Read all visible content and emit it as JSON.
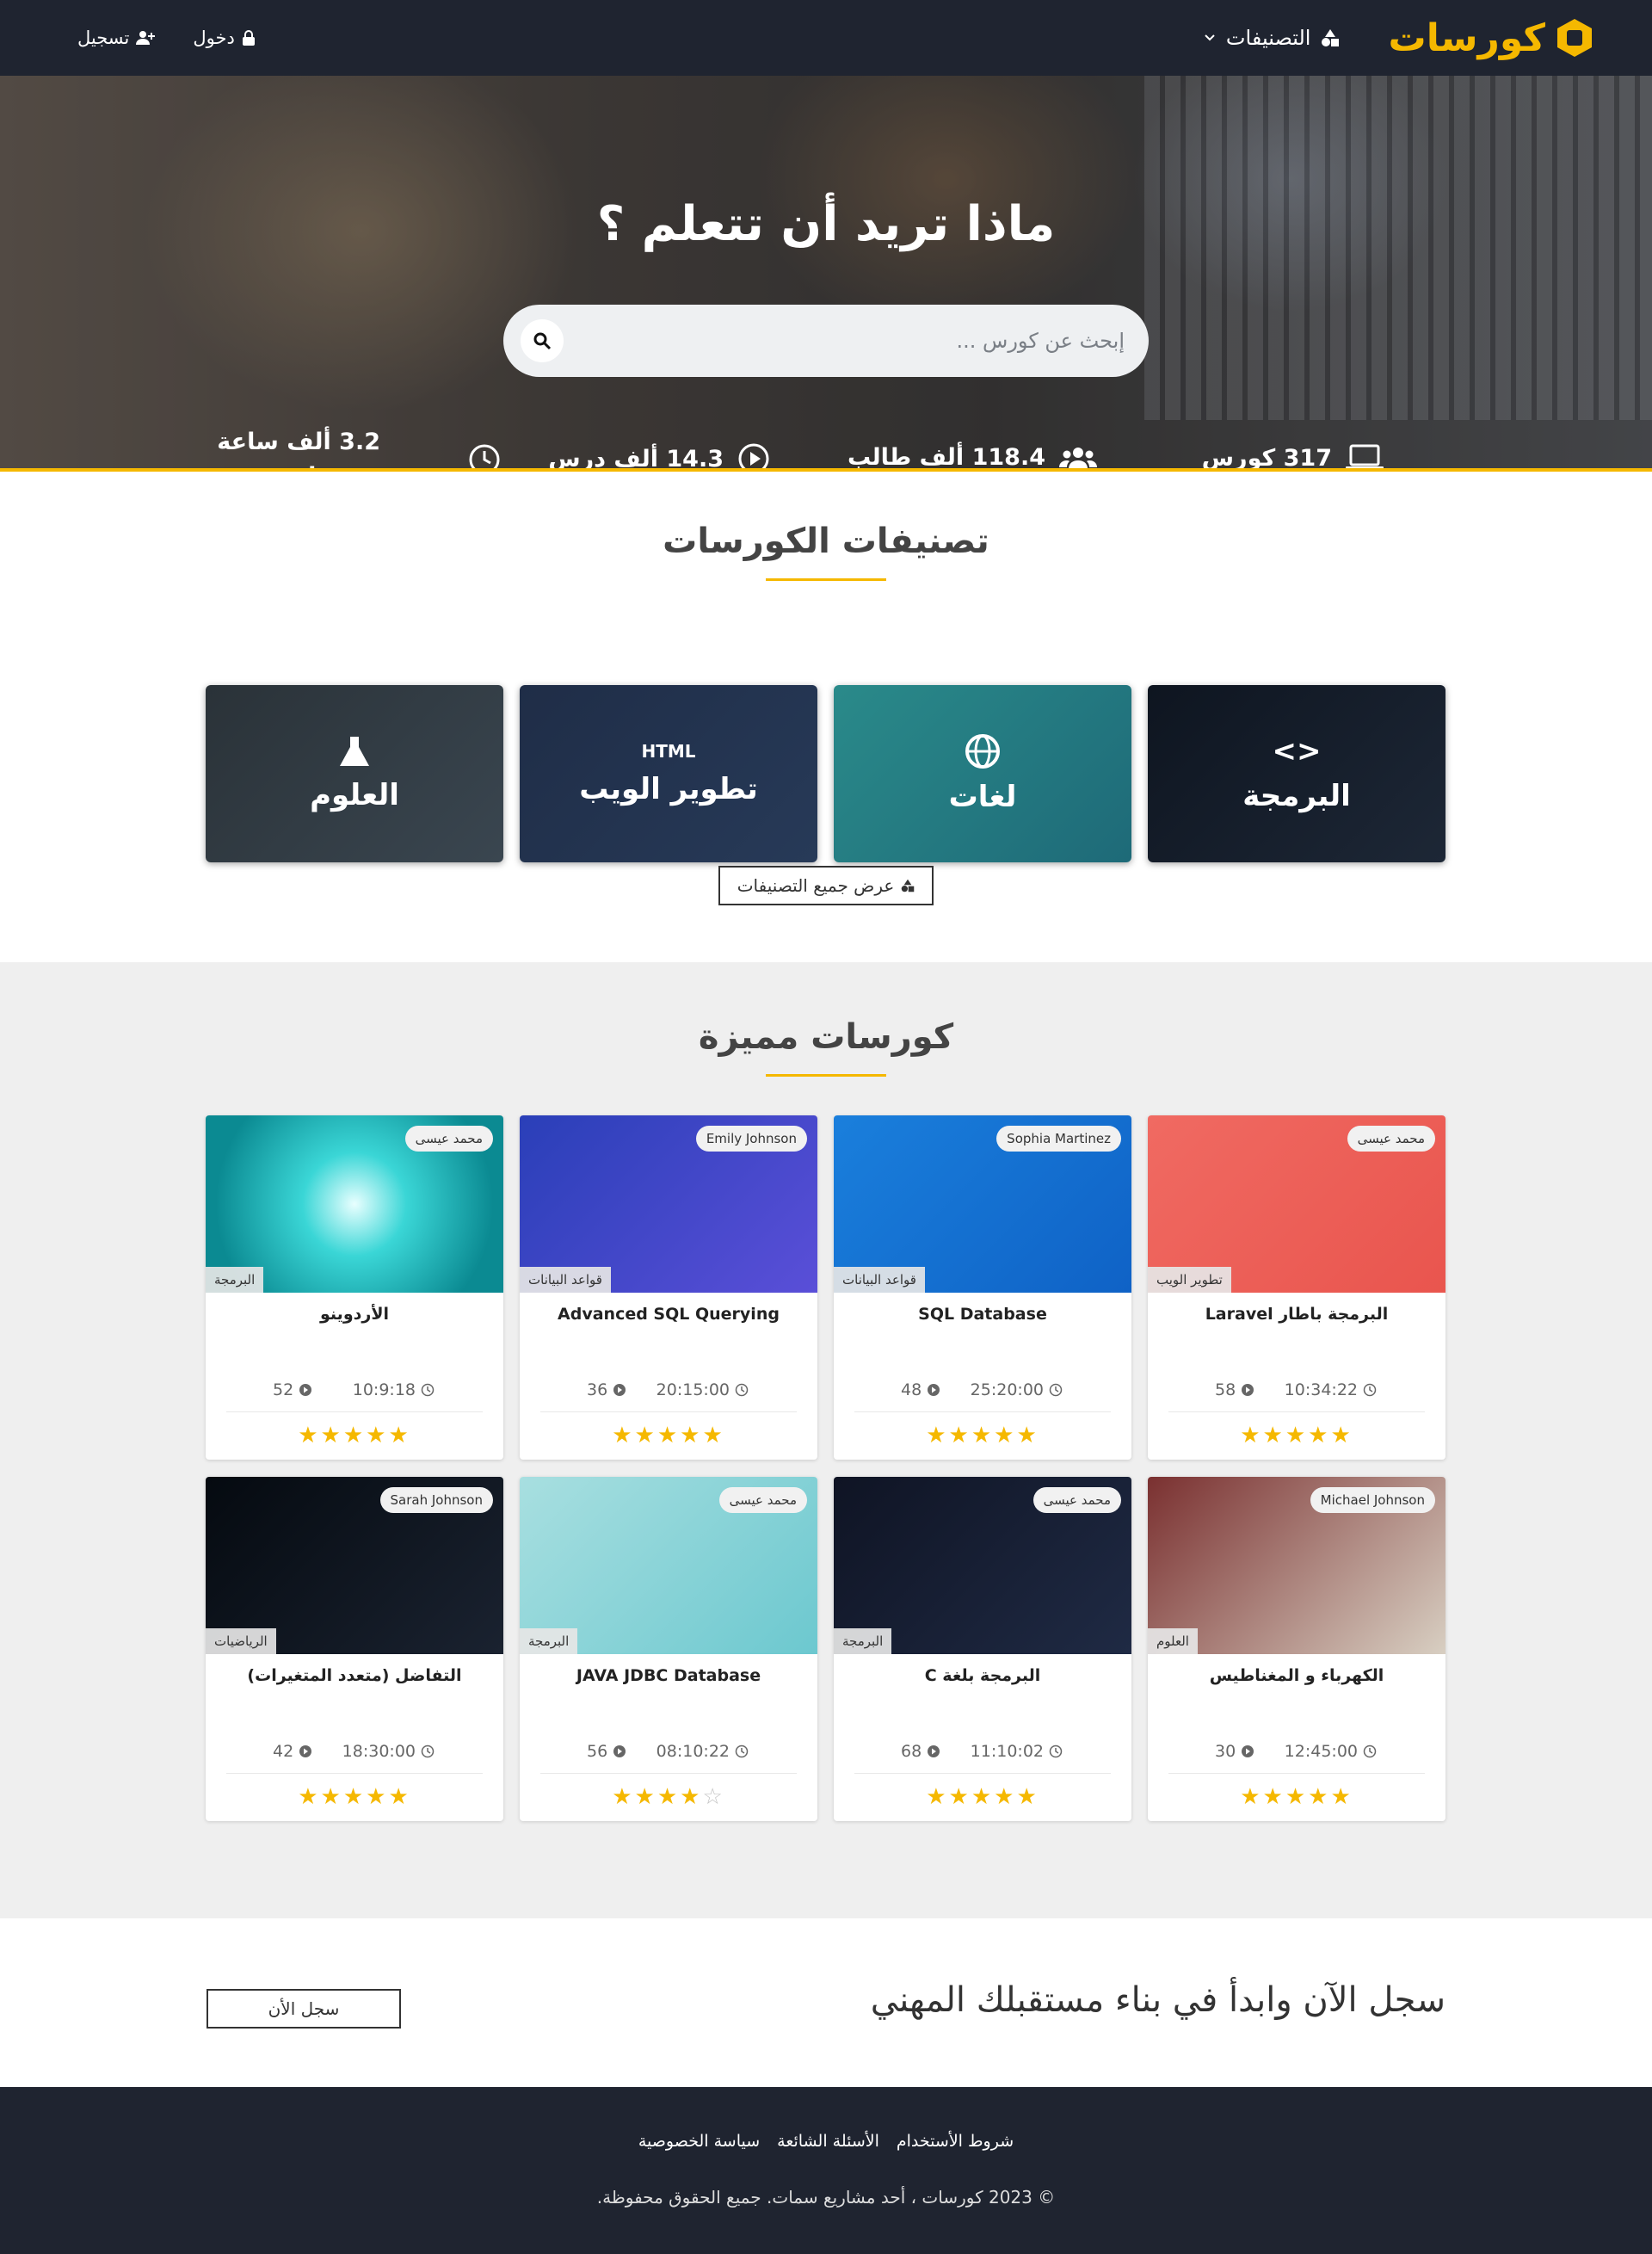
{
  "nav": {
    "logo_text": "كورسات",
    "categories_label": "التصنيفات",
    "login_label": "دخول",
    "register_label": "تسجيل"
  },
  "hero": {
    "title": "ماذا تريد أن تتعلم ؟",
    "search_placeholder": "إبحث عن كورس ...",
    "stats": {
      "courses": "317 كورس",
      "students": "118.4 ألف طالب",
      "lessons": "14.3 ألف درس",
      "hours_line1": "3.2 ألف ساعة",
      "hours_line2": "تعليمية"
    }
  },
  "categories_section": {
    "title": "تصنيفات الكورسات",
    "items": [
      {
        "label": "البرمجة",
        "icon": "code-icon"
      },
      {
        "label": "لغات",
        "icon": "globe-icon"
      },
      {
        "label": "تطوير الويب",
        "icon": "html-icon",
        "icon_text": "HTML"
      },
      {
        "label": "العلوم",
        "icon": "flask-icon"
      }
    ],
    "view_all_label": "عرض جميع التصنيفات"
  },
  "featured_section": {
    "title": "كورسات مميزة",
    "courses": [
      {
        "title": "البرمجة باطار Laravel",
        "instructor": "محمد عيسى",
        "category": "تطوير الويب",
        "duration": "10:34:22",
        "lessons": "58",
        "rating": 5
      },
      {
        "title": "SQL Database",
        "instructor": "Sophia Martinez",
        "category": "قواعد البيانات",
        "duration": "25:20:00",
        "lessons": "48",
        "rating": 5
      },
      {
        "title": "Advanced SQL Querying",
        "instructor": "Emily Johnson",
        "category": "قواعد البيانات",
        "duration": "20:15:00",
        "lessons": "36",
        "rating": 4.5
      },
      {
        "title": "الأردوينو",
        "instructor": "محمد عيسى",
        "category": "البرمجة",
        "duration": "10:9:18",
        "lessons": "52",
        "rating": 5
      },
      {
        "title": "الكهرباء و المغناطيس",
        "instructor": "Michael Johnson",
        "category": "العلوم",
        "duration": "12:45:00",
        "lessons": "30",
        "rating": 4.5
      },
      {
        "title": "البرمجة بلغة C",
        "instructor": "محمد عيسى",
        "category": "البرمجة",
        "duration": "11:10:02",
        "lessons": "68",
        "rating": 4.5
      },
      {
        "title": "JAVA JDBC Database",
        "instructor": "محمد عيسى",
        "category": "البرمجة",
        "duration": "08:10:22",
        "lessons": "56",
        "rating": 4
      },
      {
        "title": "التفاضل (متعدد المتغيرات)",
        "instructor": "Sarah Johnson",
        "category": "الرياضيات",
        "duration": "18:30:00",
        "lessons": "42",
        "rating": 4.5
      }
    ]
  },
  "cta": {
    "text": "سجل الآن وابدأ في بناء مستقبلك المهني",
    "button_label": "سجل الأن"
  },
  "footer": {
    "links": [
      "شروط الأستخدام",
      "الأسئلة الشائعة",
      "سياسة الخصوصية"
    ],
    "copyright": "© 2023 كورسات ، أحد مشاريع سمات. جميع الحقوق محفوظة."
  },
  "colors": {
    "brand": "#f5b800",
    "navbar": "#1f2430"
  }
}
